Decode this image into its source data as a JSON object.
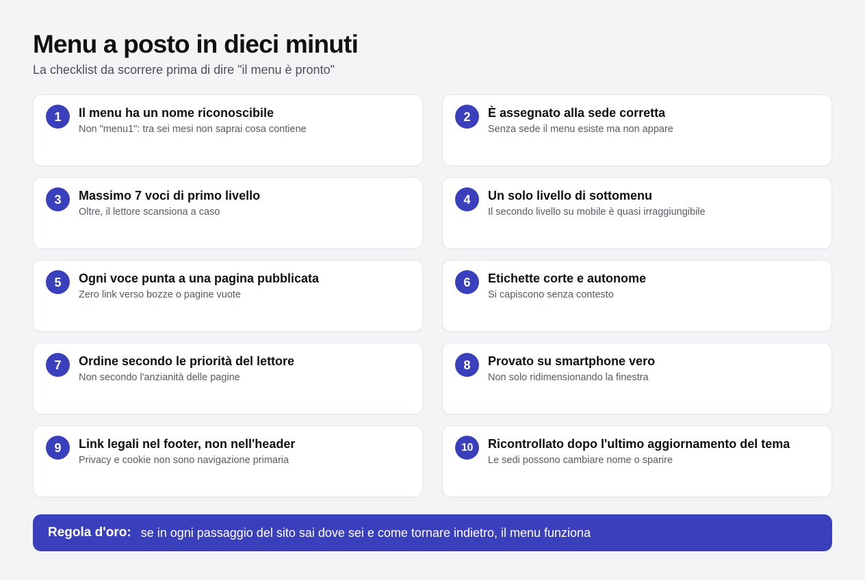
{
  "header": {
    "title": "Menu a posto in dieci minuti",
    "subtitle": "La checklist da scorrere prima di dire \"il menu è pronto\""
  },
  "checklist": [
    {
      "number": "1",
      "title": "Il menu ha un nome riconoscibile",
      "description": "Non \"menu1\": tra sei mesi non saprai cosa contiene"
    },
    {
      "number": "2",
      "title": "È assegnato alla sede corretta",
      "description": "Senza sede il menu esiste ma non appare"
    },
    {
      "number": "3",
      "title": "Massimo 7 voci di primo livello",
      "description": "Oltre, il lettore scansiona a caso"
    },
    {
      "number": "4",
      "title": "Un solo livello di sottomenu",
      "description": "Il secondo livello su mobile è quasi irraggiungibile"
    },
    {
      "number": "5",
      "title": "Ogni voce punta a una pagina pubblicata",
      "description": "Zero link verso bozze o pagine vuote"
    },
    {
      "number": "6",
      "title": "Etichette corte e autonome",
      "description": "Si capiscono senza contesto"
    },
    {
      "number": "7",
      "title": "Ordine secondo le priorità del lettore",
      "description": "Non secondo l'anzianità delle pagine"
    },
    {
      "number": "8",
      "title": "Provato su smartphone vero",
      "description": "Non solo ridimensionando la finestra"
    },
    {
      "number": "9",
      "title": "Link legali nel footer, non nell'header",
      "description": "Privacy e cookie non sono navigazione primaria"
    },
    {
      "number": "10",
      "title": "Ricontrollato dopo l'ultimo aggiornamento del tema",
      "description": "Le sedi possono cambiare nome o sparire"
    }
  ],
  "golden_rule": {
    "label": "Regola d'oro:",
    "text": "se in ogni passaggio del sito sai dove sei e come tornare indietro, il menu funziona"
  },
  "colors": {
    "accent": "#3a3fbc",
    "background": "#f3f4f6",
    "card": "#ffffff"
  }
}
